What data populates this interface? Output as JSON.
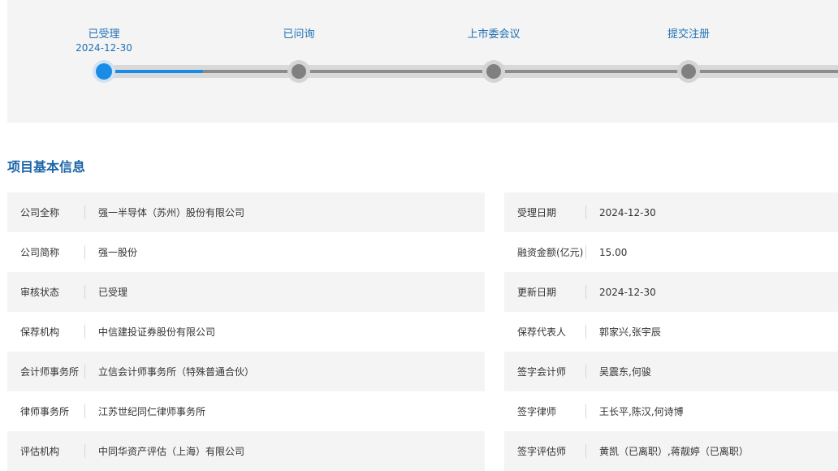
{
  "steps": [
    {
      "label": "已受理",
      "date": "2024-12-30",
      "active": true
    },
    {
      "label": "已问询",
      "date": "",
      "active": false
    },
    {
      "label": "上市委会议",
      "date": "",
      "active": false
    },
    {
      "label": "提交注册",
      "date": "",
      "active": false
    }
  ],
  "section": {
    "title": "项目基本信息"
  },
  "left_rows": [
    {
      "key": "公司全称",
      "value": "强一半导体（苏州）股份有限公司"
    },
    {
      "key": "公司简称",
      "value": "强一股份"
    },
    {
      "key": "审核状态",
      "value": "已受理"
    },
    {
      "key": "保荐机构",
      "value": "中信建投证券股份有限公司"
    },
    {
      "key": "会计师事务所",
      "value": "立信会计师事务所（特殊普通合伙）"
    },
    {
      "key": "律师事务所",
      "value": "江苏世纪同仁律师事务所"
    },
    {
      "key": "评估机构",
      "value": "中同华资产评估（上海）有限公司"
    }
  ],
  "right_rows": [
    {
      "key": "受理日期",
      "value": "2024-12-30"
    },
    {
      "key": "融资金额(亿元)",
      "value": "15.00"
    },
    {
      "key": "更新日期",
      "value": "2024-12-30"
    },
    {
      "key": "保荐代表人",
      "value": "郭家兴,张宇辰"
    },
    {
      "key": "签字会计师",
      "value": "吴震东,何骏"
    },
    {
      "key": "签字律师",
      "value": "王长平,陈汉,何诗博"
    },
    {
      "key": "签字评估师",
      "value": "黄凯（已离职）,蒋靓婷（已离职）"
    }
  ],
  "colors": {
    "accent": "#1a8ce6",
    "title": "#1a63a8",
    "inactive_node": "#808080"
  }
}
